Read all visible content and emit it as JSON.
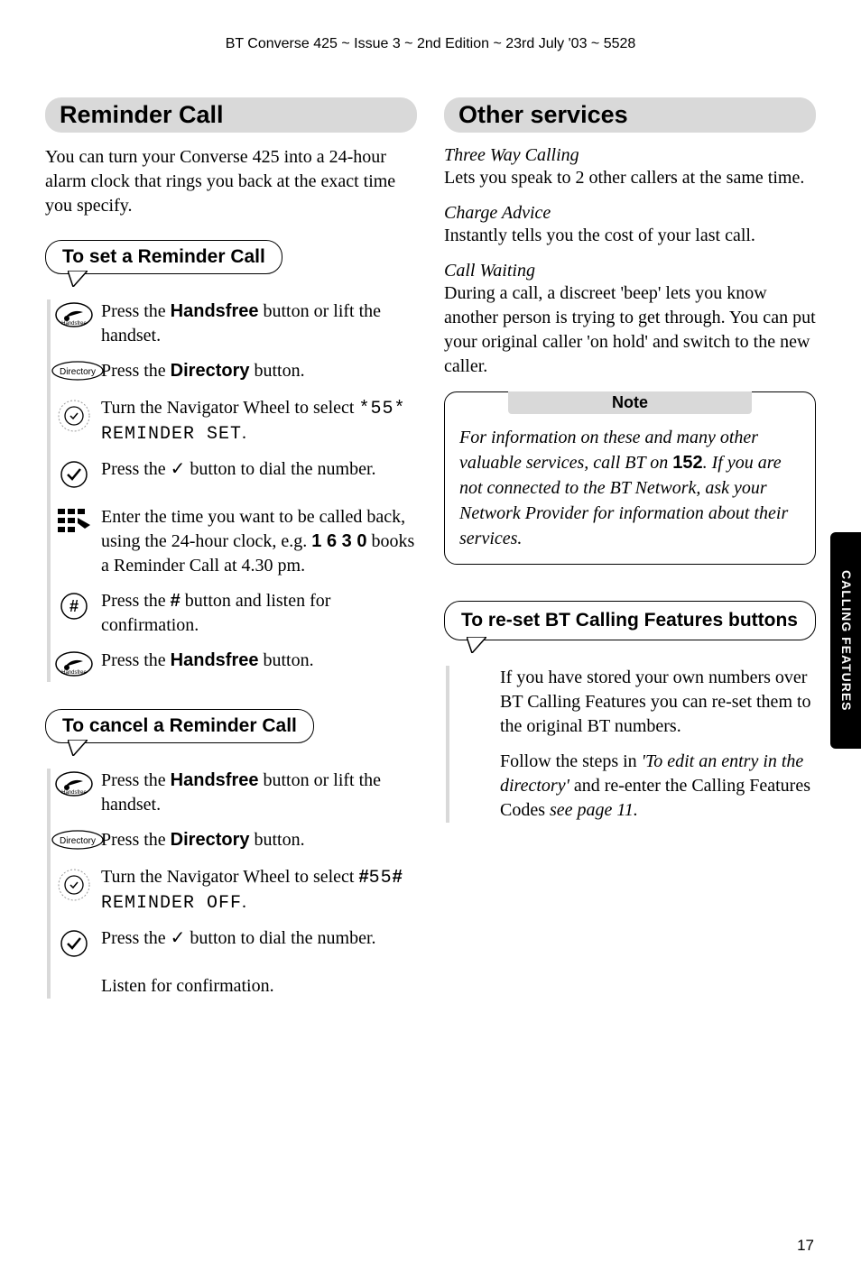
{
  "header": "BT Converse 425 ~ Issue 3 ~ 2nd Edition ~ 23rd July '03 ~ 5528",
  "side_tab": "CALLING FEATURES",
  "page_number": "17",
  "left": {
    "heading1": "Reminder Call",
    "intro": "You can turn your Converse 425 into a 24-hour alarm clock that rings you back at the exact time you specify.",
    "callout_set": "To set a Reminder Call",
    "steps_set": [
      {
        "icon": "handsfree",
        "pre": "Press the ",
        "bold": "Handsfree",
        "post": " button or lift the handset."
      },
      {
        "icon": "directory",
        "pre": "Press the ",
        "bold": "Directory",
        "post": " button."
      },
      {
        "icon": "wheel",
        "pre": "Turn the Navigator Wheel to select ",
        "lcd": "*55* REMINDER SET",
        "post": "."
      },
      {
        "icon": "tick",
        "pre": "Press the ✓ button to dial the number.",
        "bold": "",
        "post": ""
      },
      {
        "icon": "keypad",
        "pre": "Enter the time you want to be called back, using the 24-hour clock, e.g. ",
        "bold": "1 6 3 0",
        "post": " books a Reminder Call at 4.30 pm."
      },
      {
        "icon": "hash",
        "pre": "Press the ",
        "bold": "#",
        "post": " button and listen for confirmation."
      },
      {
        "icon": "handsfree",
        "pre": "Press the ",
        "bold": "Handsfree",
        "post": " button."
      }
    ],
    "callout_cancel": "To cancel a Reminder Call",
    "steps_cancel": [
      {
        "icon": "handsfree",
        "pre": "Press the ",
        "bold": "Handsfree",
        "post": " button or lift the handset."
      },
      {
        "icon": "directory",
        "pre": "Press the ",
        "bold": "Directory",
        "post": " button."
      },
      {
        "icon": "wheel",
        "pre": "Turn the Navigator Wheel to select ",
        "bold": "#",
        "lcd": "55",
        "bold2": "#",
        "lcd2": " REMINDER OFF",
        "post": "."
      },
      {
        "icon": "tick",
        "pre": "Press the ✓ button to dial the number.",
        "bold": "",
        "post": ""
      },
      {
        "icon": "none",
        "pre": "Listen for confirmation.",
        "bold": "",
        "post": ""
      }
    ]
  },
  "right": {
    "heading1": "Other services",
    "services": [
      {
        "title": "Three Way Calling",
        "body": "Lets you speak to 2 other callers at the same time."
      },
      {
        "title": "Charge Advice",
        "body": "Instantly tells you the cost of your last call."
      },
      {
        "title": "Call Waiting",
        "body": "During a call, a discreet 'beep' lets you know another person is trying to get through. You can put your original caller 'on hold' and switch to the new caller."
      }
    ],
    "note_label": "Note",
    "note_pre": "For information on these and many other valuable services, call BT on ",
    "note_bold": "152",
    "note_post": ". If you are not connected to the BT Network, ask your Network Provider for information about their services.",
    "reset_heading": "To re-set BT Calling Features buttons",
    "reset_para1": "If you have stored your own numbers over BT Calling Features you can re-set them to the original BT numbers.",
    "reset_para2_pre": "Follow the steps in ",
    "reset_para2_it1": "'To edit an entry in the directory'",
    "reset_para2_mid": " and re-enter the Calling Features Codes ",
    "reset_para2_it2": "see page 11."
  }
}
